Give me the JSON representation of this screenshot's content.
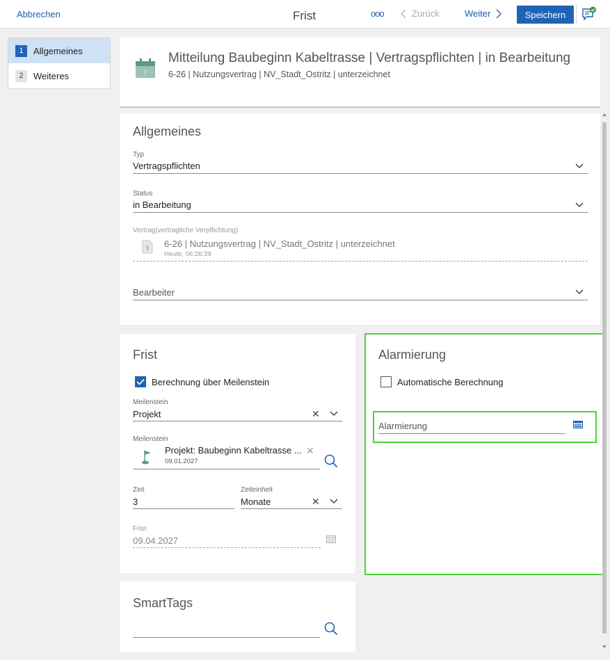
{
  "topbar": {
    "cancel_label": "Abbrechen",
    "title": "Frist",
    "more_label": "ooo",
    "back_label": "Zurück",
    "next_label": "Weiter",
    "save_label": "Speichern"
  },
  "steps": [
    {
      "num": "1",
      "label": "Allgemeines",
      "active": true
    },
    {
      "num": "2",
      "label": "Weiteres",
      "active": false
    }
  ],
  "header": {
    "title": "Mitteilung Baubeginn Kabeltrasse | Vertragspflichten | in Bearbeitung",
    "subtitle": "6-26 | Nutzungsvertrag | NV_Stadt_Ostritz | unterzeichnet",
    "icon": "calendar-icon"
  },
  "general": {
    "title": "Allgemeines",
    "typ_label": "Typ",
    "typ_value": "Vertragspflichten",
    "status_label": "Status",
    "status_value": "in Bearbeitung",
    "vertrag_label": "Vertrag(vertragliche Verpflichtung)",
    "vertrag_value": "6-26 | Nutzungsvertrag | NV_Stadt_Ostritz | unterzeichnet",
    "vertrag_meta": "Heute, 06:26:39",
    "bearbeiter_placeholder": "Bearbeiter"
  },
  "frist": {
    "title": "Frist",
    "milestone_checkbox_label": "Berechnung über Meilenstein",
    "milestone_checkbox_checked": true,
    "meilenstein1_label": "Meilenstein",
    "meilenstein1_value": "Projekt",
    "meilenstein2_label": "Meilenstein",
    "meilenstein2_value": "Projekt: Baubeginn Kabeltrasse ...",
    "meilenstein2_date": "09.01.2027",
    "zeit_label": "Zeit",
    "zeit_value": "3",
    "zeiteinheit_label": "Zeiteinheit",
    "zeiteinheit_value": "Monate",
    "frist_label": "Frist",
    "frist_value": "09.04.2027"
  },
  "alarm": {
    "title": "Alarmierung",
    "auto_checkbox_label": "Automatische Berechnung",
    "auto_checkbox_checked": false,
    "field_placeholder": "Alarmierung"
  },
  "smarttags": {
    "title": "SmartTags"
  },
  "colors": {
    "accent": "#1f63b6",
    "highlight": "#4cd137",
    "active_step": "#cfe1f5"
  }
}
